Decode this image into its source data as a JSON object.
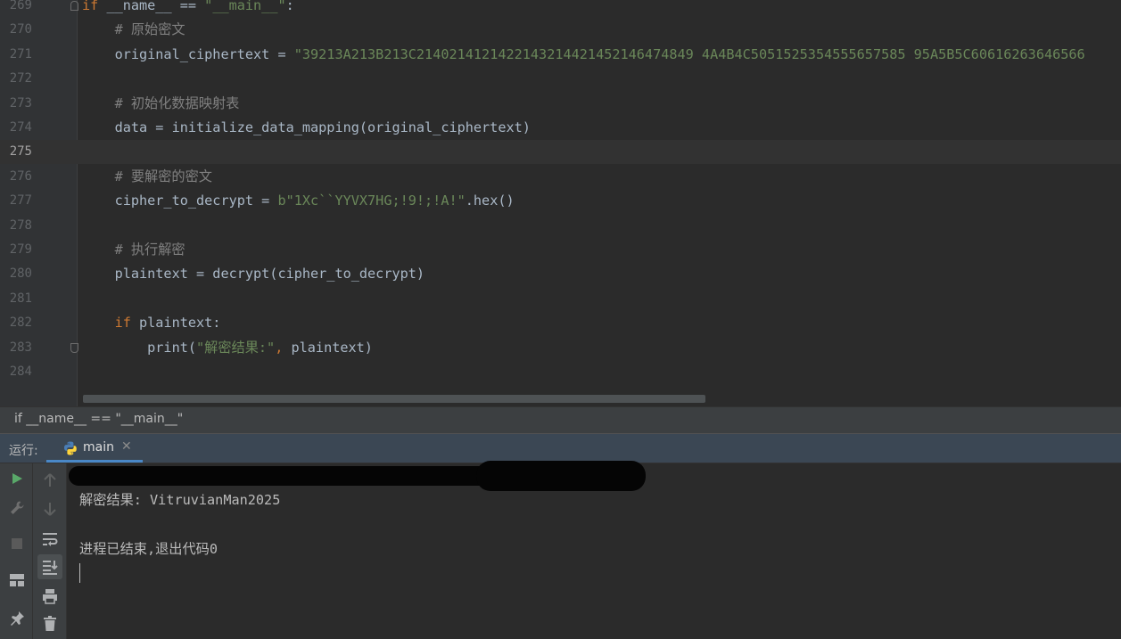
{
  "editor": {
    "lines": [
      {
        "num": "269",
        "tokens": [
          {
            "t": "if ",
            "c": "kw"
          },
          {
            "t": "__name__",
            "c": "fn"
          },
          {
            "t": " == ",
            "c": "fn"
          },
          {
            "t": "\"__main__\"",
            "c": "str"
          },
          {
            "t": ":",
            "c": "fn"
          }
        ]
      },
      {
        "num": "270",
        "tokens": [
          {
            "t": "    # 原始密文",
            "c": "cm"
          }
        ]
      },
      {
        "num": "271",
        "tokens": [
          {
            "t": "    original_ciphertext = ",
            "c": "fn"
          },
          {
            "t": "\"39213A213B213C2140214121422143214421452146474849 4A4B4C5051525354555657585 95A5B5C60616263646566",
            "c": "str"
          }
        ]
      },
      {
        "num": "272",
        "tokens": []
      },
      {
        "num": "273",
        "tokens": [
          {
            "t": "    # 初始化数据映射表",
            "c": "cm"
          }
        ]
      },
      {
        "num": "274",
        "tokens": [
          {
            "t": "    data = initialize_data_mapping(original_ciphertext)",
            "c": "fn"
          }
        ]
      },
      {
        "num": "275",
        "tokens": []
      },
      {
        "num": "276",
        "tokens": [
          {
            "t": "    # 要解密的密文",
            "c": "cm"
          }
        ]
      },
      {
        "num": "277",
        "tokens": [
          {
            "t": "    cipher_to_decrypt = ",
            "c": "fn"
          },
          {
            "t": "b\"1Xc``YYVX7HG;!9!;!A!\"",
            "c": "str"
          },
          {
            "t": ".hex()",
            "c": "fn"
          }
        ]
      },
      {
        "num": "278",
        "tokens": []
      },
      {
        "num": "279",
        "tokens": [
          {
            "t": "    # 执行解密",
            "c": "cm"
          }
        ]
      },
      {
        "num": "280",
        "tokens": [
          {
            "t": "    plaintext = decrypt(cipher_to_decrypt)",
            "c": "fn"
          }
        ]
      },
      {
        "num": "281",
        "tokens": []
      },
      {
        "num": "282",
        "tokens": [
          {
            "t": "    ",
            "c": "fn"
          },
          {
            "t": "if ",
            "c": "kw"
          },
          {
            "t": "plaintext:",
            "c": "fn"
          }
        ]
      },
      {
        "num": "283",
        "tokens": [
          {
            "t": "        print(",
            "c": "fn"
          },
          {
            "t": "\"解密结果:\"",
            "c": "str"
          },
          {
            "t": ", ",
            "c": "kw"
          },
          {
            "t": "plaintext)",
            "c": "fn"
          }
        ]
      },
      {
        "num": "284",
        "tokens": []
      }
    ],
    "current_line": "275"
  },
  "breadcrumb": {
    "text": "if __name__ == \"__main__\""
  },
  "run": {
    "label": "运行:",
    "tab_label": "main",
    "tab_icon": "python-icon",
    "output": {
      "result_line": "解密结果: VitruvianMan2025",
      "exit_line": "进程已结束,退出代码0"
    }
  },
  "toolbar_icons": [
    "run-icon",
    "wrench-icon",
    "stop-icon",
    "layout-icon",
    "pin-icon",
    "up-arrow-icon",
    "down-arrow-icon",
    "soft-wrap-icon",
    "scroll-to-end-icon",
    "print-icon",
    "trash-icon"
  ]
}
